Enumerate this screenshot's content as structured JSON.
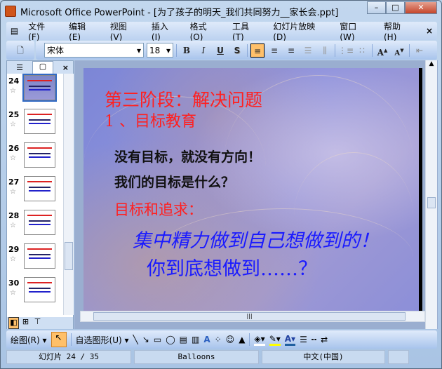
{
  "window": {
    "title": "Microsoft Office PowerPoint - [为了孩子的明天_我们共同努力__家长会.ppt]",
    "minimize": "–",
    "maximize": "□",
    "close": "✕"
  },
  "menu": [
    "文件(F)",
    "编辑(E)",
    "视图(V)",
    "插入(I)",
    "格式(O)",
    "工具(T)",
    "幻灯片放映(D)",
    "窗口(W)",
    "帮助(H)"
  ],
  "menu_close": "×",
  "format": {
    "font": "宋体",
    "size": "18",
    "bold": "B",
    "italic": "I",
    "underline": "U",
    "shadow": "S"
  },
  "panel": {
    "close": "×",
    "slides": [
      {
        "num": "24"
      },
      {
        "num": "25"
      },
      {
        "num": "26"
      },
      {
        "num": "27"
      },
      {
        "num": "28"
      },
      {
        "num": "29"
      },
      {
        "num": "30"
      }
    ],
    "current": "24"
  },
  "slide": {
    "title": "第三阶段：解决问题",
    "subtitle": "1 、目标教育",
    "line1": "没有目标，就没有方向！",
    "line2": "我们的目标是什么？",
    "line3": "目标和追求：",
    "line4": "集中精力做到自己想做到的！",
    "line5": "你到底想做到……？"
  },
  "colors": {
    "title": "#ff2020",
    "dark": "#111111",
    "blue": "#1a1aff"
  },
  "drawing": {
    "draw_label": "绘图(R)",
    "autoshape_label": "自选图形(U)"
  },
  "status": {
    "slide": "幻灯片 24 / 35",
    "design": "Balloons",
    "lang": "中文(中国)"
  }
}
